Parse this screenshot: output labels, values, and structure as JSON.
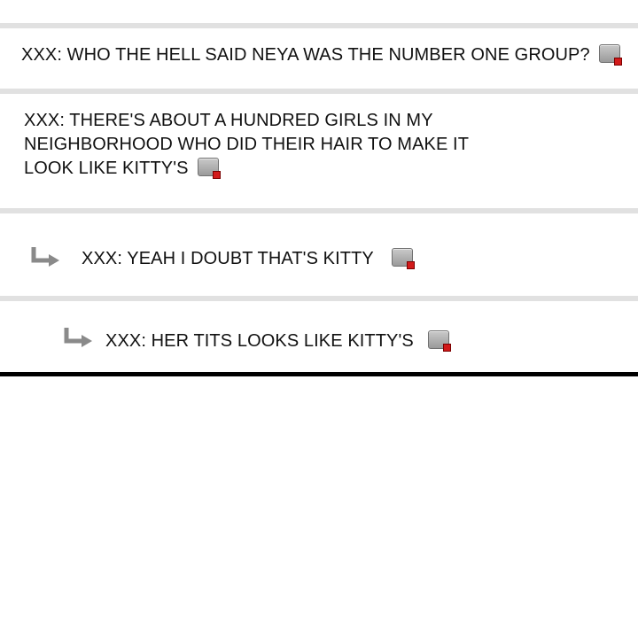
{
  "comments": [
    {
      "author": "XXX",
      "text": "XXX: WHO THE HELL SAID NEYA WAS THE NUMBER ONE GROUP?",
      "icon": "report-icon"
    },
    {
      "author": "XXX",
      "text": "XXX: THERE'S ABOUT A HUNDRED GIRLS IN MY NEIGHBORHOOD WHO DID THEIR HAIR TO MAKE IT LOOK LIKE KITTY'S",
      "icon": "report-icon"
    },
    {
      "author": "XXX",
      "text": "XXX: YEAH I DOUBT THAT'S KITTY",
      "icon": "report-icon",
      "reply_icon": "reply-arrow-icon"
    },
    {
      "author": "XXX",
      "text": "XXX: HER TITS LOOKS LIKE KITTY'S",
      "icon": "report-icon",
      "reply_icon": "reply-arrow-icon"
    }
  ],
  "colors": {
    "divider": "#e1e1e1",
    "text": "#111111",
    "reply_arrow": "#8a8a8a",
    "report_dot": "#d21a1a"
  }
}
